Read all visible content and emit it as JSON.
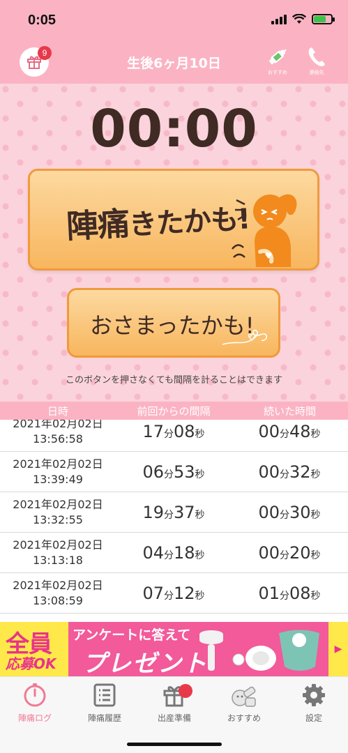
{
  "status_bar": {
    "time": "0:05"
  },
  "nav": {
    "title": "生後6ヶ月10日",
    "gift_badge_count": "9",
    "recommend_label": "おすすめ",
    "phone_label": "連絡先"
  },
  "timer": {
    "display": "00:00"
  },
  "buttons": {
    "start_big": "陣痛",
    "start_rest": "きたかも!",
    "stop": "おさまったかも!"
  },
  "hint": "このボタンを押さなくても間隔を計ることはできます",
  "table": {
    "headers": [
      "日時",
      "前回からの間隔",
      "続いた時間"
    ],
    "units": {
      "min": "分",
      "sec": "秒"
    },
    "rows": [
      {
        "date": "2021年02月02日",
        "time": "13:56:58",
        "int_min": "17",
        "int_sec": "08",
        "dur_min": "00",
        "dur_sec": "48"
      },
      {
        "date": "2021年02月02日",
        "time": "13:39:49",
        "int_min": "06",
        "int_sec": "53",
        "dur_min": "00",
        "dur_sec": "32"
      },
      {
        "date": "2021年02月02日",
        "time": "13:32:55",
        "int_min": "19",
        "int_sec": "37",
        "dur_min": "00",
        "dur_sec": "30"
      },
      {
        "date": "2021年02月02日",
        "time": "13:13:18",
        "int_min": "04",
        "int_sec": "18",
        "dur_min": "00",
        "dur_sec": "20"
      },
      {
        "date": "2021年02月02日",
        "time": "13:08:59",
        "int_min": "07",
        "int_sec": "12",
        "dur_min": "01",
        "dur_sec": "08"
      }
    ]
  },
  "banner": {
    "all": "全員",
    "apply_ok": "応募OK",
    "question": "アンケートに答えて",
    "present": "プレゼント"
  },
  "tabs": [
    {
      "label": "陣痛ログ",
      "icon": "clock-icon",
      "active": true
    },
    {
      "label": "陣痛履歴",
      "icon": "list-icon",
      "active": false
    },
    {
      "label": "出産準備",
      "icon": "gift-icon",
      "active": false
    },
    {
      "label": "おすすめ",
      "icon": "baby-items-icon",
      "active": false
    },
    {
      "label": "設定",
      "icon": "gear-icon",
      "active": false
    }
  ],
  "colors": {
    "pink": "#fbb3c3",
    "orange": "#f8b65e",
    "accent": "#f07a95",
    "badge": "#e8394a"
  }
}
